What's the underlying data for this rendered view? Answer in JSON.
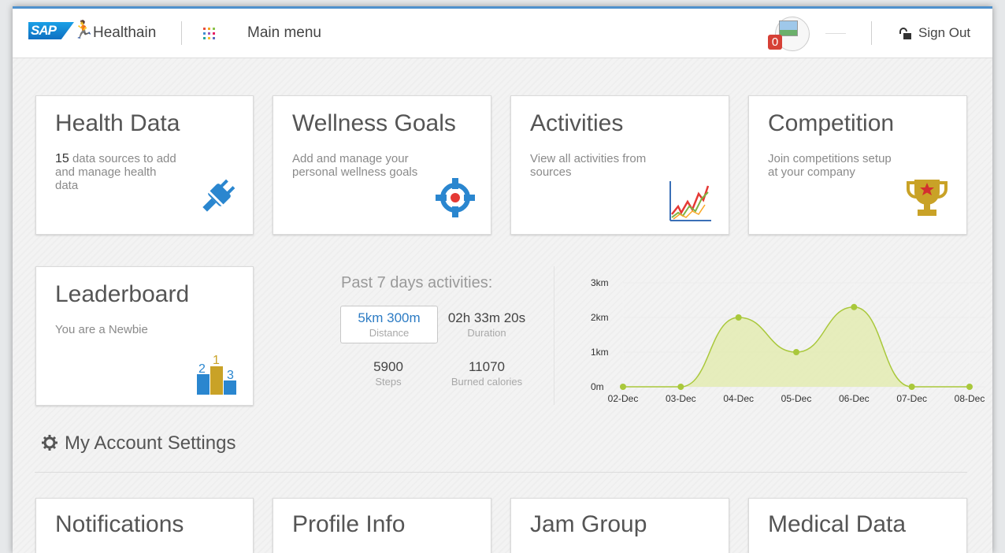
{
  "header": {
    "logo_text": "SAP",
    "app_name": "Healthain",
    "main_menu_label": "Main menu",
    "notification_count": "0",
    "signout_label": "Sign Out",
    "grid_colors": [
      "#e94e3c",
      "#f5a623",
      "#8bc34a",
      "#3f8fd2",
      "#9b59b6",
      "#e91e63",
      "#26a69a",
      "#fbc02d",
      "#5c6bc0"
    ]
  },
  "tiles": [
    {
      "title": "Health Data",
      "count": "15",
      "desc": "data sources to add and manage health data",
      "icon": "plug-icon"
    },
    {
      "title": "Wellness Goals",
      "desc": "Add and manage your personal wellness goals",
      "icon": "target-icon"
    },
    {
      "title": "Activities",
      "desc": "View all activities from sources",
      "icon": "trend-chart-icon"
    },
    {
      "title": "Competition",
      "desc": "Join competitions setup at your company",
      "icon": "trophy-icon"
    }
  ],
  "leaderboard": {
    "title": "Leaderboard",
    "desc": "You are a Newbie",
    "icon": "podium-icon",
    "podium_labels": [
      "2",
      "1",
      "3"
    ]
  },
  "stats": {
    "title": "Past 7 days activities:",
    "distance": {
      "value": "5km 300m",
      "label": "Distance"
    },
    "duration": {
      "value": "02h 33m 20s",
      "label": "Duration"
    },
    "steps": {
      "value": "5900",
      "label": "Steps"
    },
    "calories": {
      "value": "11070",
      "label": "Burned calories"
    }
  },
  "chart_data": {
    "type": "area",
    "categories": [
      "02-Dec",
      "03-Dec",
      "04-Dec",
      "05-Dec",
      "06-Dec",
      "07-Dec",
      "08-Dec"
    ],
    "values": [
      0,
      0,
      2,
      1,
      2.3,
      0,
      0
    ],
    "ylim": [
      0,
      3
    ],
    "yticks": [
      "0m",
      "1km",
      "2km",
      "3km"
    ],
    "grid": true,
    "colors": {
      "line": "#a9c83b",
      "fill": "#e3ebb1",
      "point": "#a9c83b"
    }
  },
  "settings": {
    "label": "My Account Settings",
    "icon": "gear-icon"
  },
  "bottom_tiles": [
    {
      "title": "Notifications"
    },
    {
      "title": "Profile Info"
    },
    {
      "title": "Jam Group"
    },
    {
      "title": "Medical Data"
    }
  ]
}
